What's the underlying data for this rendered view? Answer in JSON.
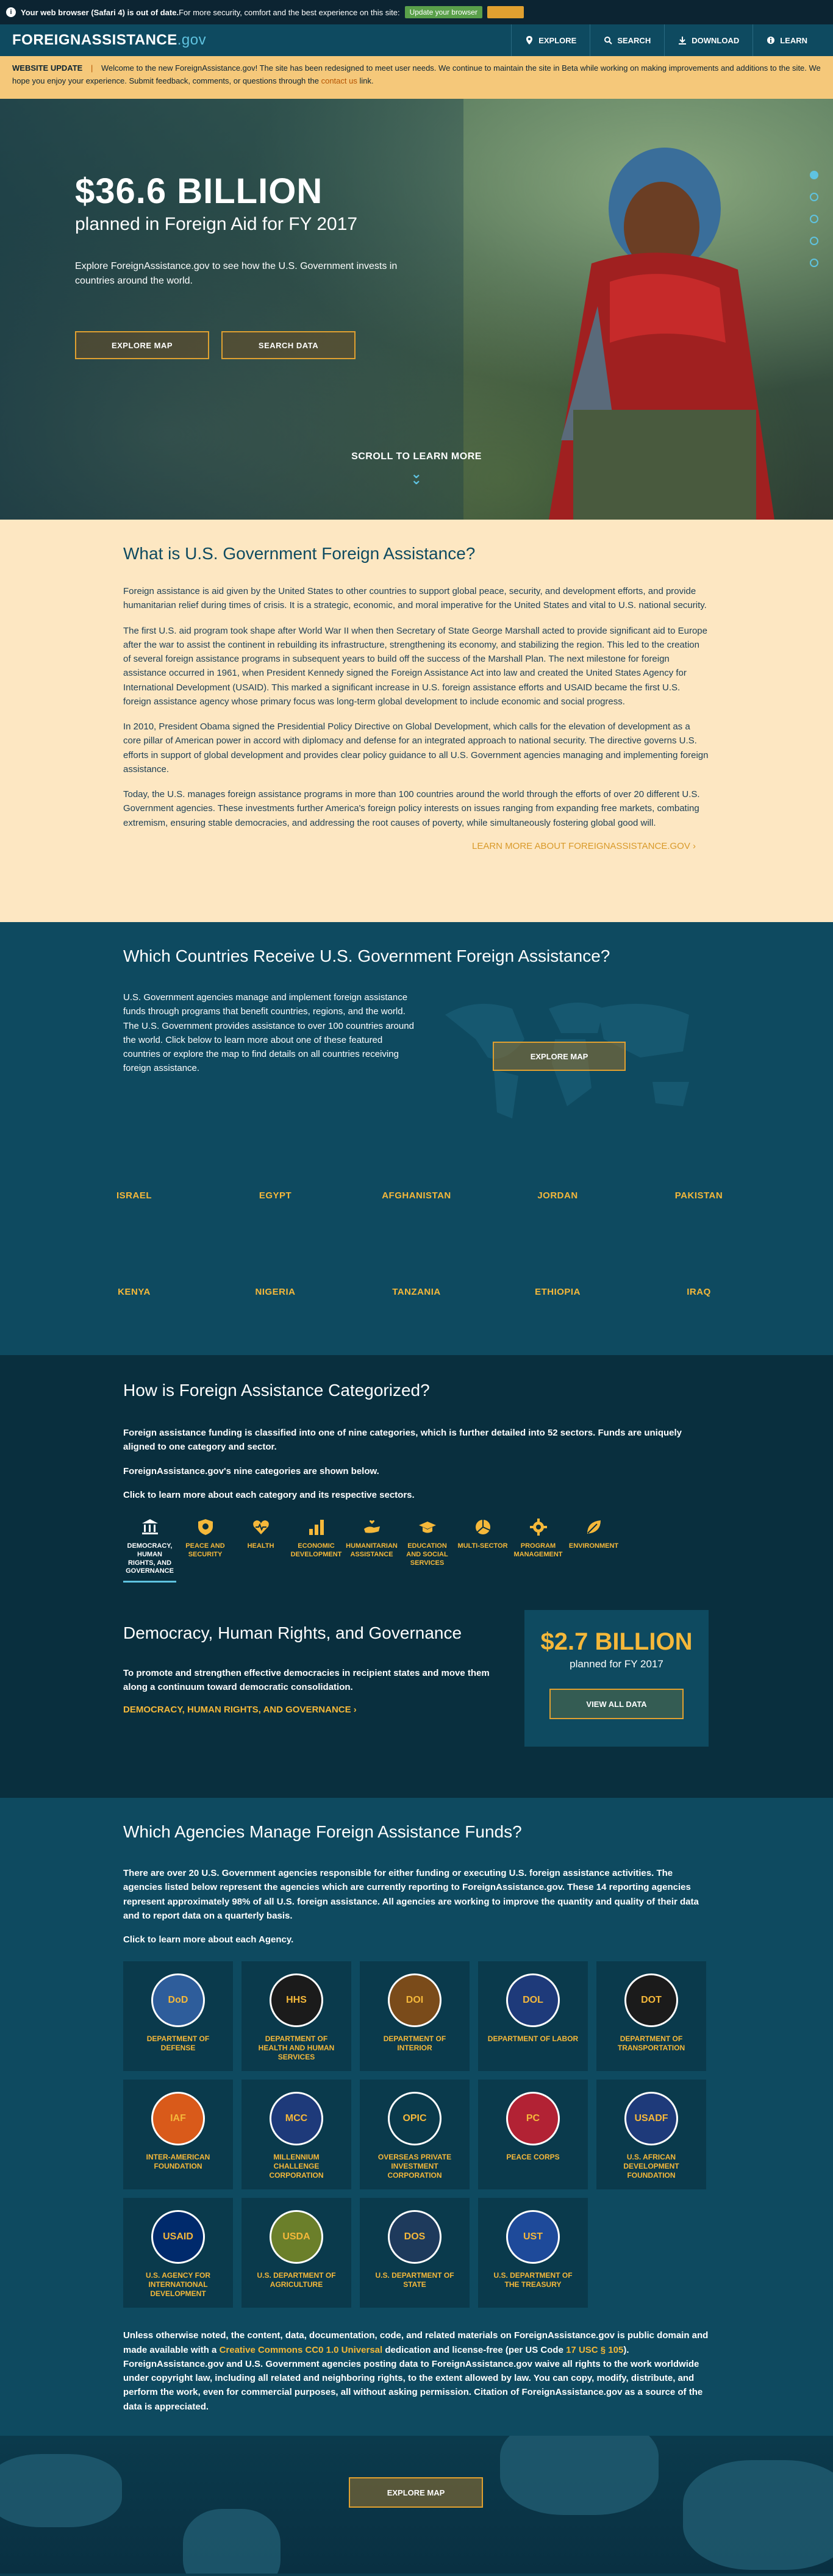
{
  "browser_warning": {
    "text_bold": "Your web browser (Safari 4) is out of date.",
    "text": " For more security, comfort and the best experience on this site:",
    "update_label": "Update your browser"
  },
  "nav": {
    "logo_main": "FOREIGNASSISTANCE",
    "logo_suffix": ".gov",
    "items": [
      {
        "label": "EXPLORE",
        "icon": "map-pin-icon"
      },
      {
        "label": "SEARCH",
        "icon": "search-icon"
      },
      {
        "label": "DOWNLOAD",
        "icon": "download-icon"
      },
      {
        "label": "LEARN",
        "icon": "info-icon"
      }
    ]
  },
  "update_banner": {
    "title": "WEBSITE UPDATE",
    "separator": "|",
    "text": "Welcome to the new ForeignAssistance.gov! The site has been redesigned to meet user needs. We continue to maintain the site in Beta while working on making improvements and additions to the site. We hope you enjoy your experience. Submit feedback, comments, or questions through the",
    "link": "contact us",
    "suffix": " link."
  },
  "hero": {
    "amount": "$36.6 BILLION",
    "subtitle": "planned in Foreign Aid for FY 2017",
    "description": "Explore ForeignAssistance.gov to see how the U.S. Government invests in countries around the world.",
    "btn_explore": "EXPLORE MAP",
    "btn_search": "SEARCH DATA",
    "scroll_label": "SCROLL TO LEARN MORE"
  },
  "what": {
    "title": "What is U.S. Government Foreign Assistance?",
    "paragraphs": [
      "Foreign assistance is aid given by the United States to other countries to support global peace, security, and development efforts, and provide humanitarian relief during times of crisis. It is a strategic, economic, and moral imperative for the United States and vital to U.S. national security.",
      "The first U.S. aid program took shape after World War II when then Secretary of State George Marshall acted to provide significant aid to Europe after the war to assist the continent in rebuilding its infrastructure, strengthening its economy, and stabilizing the region. This led to the creation of several foreign assistance programs in subsequent years to build off the success of the Marshall Plan. The next milestone for foreign assistance occurred in 1961, when President Kennedy signed the Foreign Assistance Act into law and created the United States Agency for International Development (USAID). This marked a significant increase in U.S. foreign assistance efforts and USAID became the first U.S. foreign assistance agency whose primary focus was long-term global development to include economic and social progress.",
      "In 2010, President Obama signed the Presidential Policy Directive on Global Development, which calls for the elevation of development as a core pillar of American power in accord with diplomacy and defense for an integrated approach to national security. The directive governs U.S. efforts in support of global development and provides clear policy guidance to all U.S. Government agencies managing and implementing foreign assistance.",
      "Today, the U.S. manages foreign assistance programs in more than 100 countries around the world through the efforts of over 20 different U.S. Government agencies. These investments further America's foreign policy interests on issues ranging from expanding free markets, combating extremism, ensuring stable democracies, and addressing the root causes of poverty, while simultaneously fostering global good will."
    ],
    "learn_more": "LEARN MORE ABOUT FOREIGNASSISTANCE.GOV"
  },
  "countries": {
    "title": "Which Countries Receive U.S. Government Foreign Assistance?",
    "description": "U.S. Government agencies manage and implement foreign assistance funds through programs that benefit countries, regions, and the world. The U.S. Government provides assistance to over 100 countries around the world. Click below to learn more about one of these featured countries or explore the map to find details on all countries receiving foreign assistance.",
    "explore_label": "EXPLORE MAP",
    "row1": [
      "ISRAEL",
      "EGYPT",
      "AFGHANISTAN",
      "JORDAN",
      "PAKISTAN"
    ],
    "row2": [
      "KENYA",
      "NIGERIA",
      "TANZANIA",
      "ETHIOPIA",
      "IRAQ"
    ]
  },
  "categories": {
    "title": "How is Foreign Assistance Categorized?",
    "p1": "Foreign assistance funding is classified into one of nine categories, which is further detailed into 52 sectors. Funds are uniquely aligned to one category and sector.",
    "p2": "ForeignAssistance.gov's nine categories are shown below.",
    "p3": "Click to learn more about each category and its respective sectors.",
    "items": [
      {
        "label": "DEMOCRACY, HUMAN RIGHTS, AND GOVERNANCE",
        "icon": "government-building-icon"
      },
      {
        "label": "PEACE AND SECURITY",
        "icon": "shield-icon"
      },
      {
        "label": "HEALTH",
        "icon": "heart-pulse-icon"
      },
      {
        "label": "ECONOMIC DEVELOPMENT",
        "icon": "bar-chart-icon"
      },
      {
        "label": "HUMANITARIAN ASSISTANCE",
        "icon": "helping-hand-icon"
      },
      {
        "label": "EDUCATION AND SOCIAL SERVICES",
        "icon": "graduation-cap-icon"
      },
      {
        "label": "MULTI-SECTOR",
        "icon": "pie-chart-icon"
      },
      {
        "label": "PROGRAM MANAGEMENT",
        "icon": "gear-icon"
      },
      {
        "label": "ENVIRONMENT",
        "icon": "leaf-icon"
      }
    ],
    "selected_title": "Democracy, Human Rights, and Governance",
    "selected_desc": "To promote and strengthen effective democracies in recipient states and move them along a continuum toward democratic consolidation.",
    "selected_link": "DEMOCRACY, HUMAN RIGHTS, AND GOVERNANCE",
    "amount": "$2.7 BILLION",
    "amount_sub": "planned for FY 2017",
    "view_label": "VIEW ALL DATA"
  },
  "agencies": {
    "title": "Which Agencies Manage Foreign Assistance Funds?",
    "p1": "There are over 20 U.S. Government agencies responsible for either funding or executing U.S. foreign assistance activities. The agencies listed below represent the agencies which are currently reporting to ForeignAssistance.gov. These 14 reporting agencies represent approximately 98% of all U.S. foreign assistance. All agencies are working to improve the quantity and quality of their data and to report data on a quarterly basis.",
    "p2": "Click to learn more about each Agency.",
    "items": [
      {
        "label": "DEPARTMENT OF DEFENSE",
        "seal": "DoD",
        "color": "#2e5d9b"
      },
      {
        "label": "DEPARTMENT OF HEALTH AND HUMAN SERVICES",
        "seal": "HHS",
        "color": "#1b1b1b"
      },
      {
        "label": "DEPARTMENT OF INTERIOR",
        "seal": "DOI",
        "color": "#7a4b1a"
      },
      {
        "label": "DEPARTMENT OF LABOR",
        "seal": "DOL",
        "color": "#1e3a7a"
      },
      {
        "label": "DEPARTMENT OF TRANSPORTATION",
        "seal": "DOT",
        "color": "#1b1b1b"
      },
      {
        "label": "INTER-AMERICAN FOUNDATION",
        "seal": "IAF",
        "color": "#d95a1a"
      },
      {
        "label": "MILLENNIUM CHALLENGE CORPORATION",
        "seal": "MCC",
        "color": "#1e3a7a"
      },
      {
        "label": "OVERSEAS PRIVATE INVESTMENT CORPORATION",
        "seal": "OPIC",
        "color": "#0a3a4c"
      },
      {
        "label": "PEACE CORPS",
        "seal": "PC",
        "color": "#b22234"
      },
      {
        "label": "U.S. AFRICAN DEVELOPMENT FOUNDATION",
        "seal": "USADF",
        "color": "#1e3a7a"
      },
      {
        "label": "U.S. AGENCY FOR INTERNATIONAL DEVELOPMENT",
        "seal": "USAID",
        "color": "#002a6c"
      },
      {
        "label": "U.S. DEPARTMENT OF AGRICULTURE",
        "seal": "USDA",
        "color": "#6b7f2a"
      },
      {
        "label": "U.S. DEPARTMENT OF STATE",
        "seal": "DOS",
        "color": "#1e3a5c"
      },
      {
        "label": "U.S. DEPARTMENT OF THE TREASURY",
        "seal": "UST",
        "color": "#1e4a9a"
      }
    ],
    "legal_pre": "Unless otherwise noted, the content, data, documentation, code, and related materials on ForeignAssistance.gov is public domain and made available with a ",
    "legal_link1": "Creative Commons CC0 1.0 Universal",
    "legal_mid": " dedication and license-free (per US Code ",
    "legal_link2": "17 USC § 105",
    "legal_post": "). ForeignAssistance.gov and U.S. Government agencies posting data to ForeignAssistance.gov waive all rights to the work worldwide under copyright law, including all related and neighboring rights, to the extent allowed by law. You can copy, modify, distribute, and perform the work, even for commercial purposes, all without asking permission. Citation of ForeignAssistance.gov as a source of the data is appreciated."
  },
  "footer": {
    "explore_label": "EXPLORE MAP"
  }
}
